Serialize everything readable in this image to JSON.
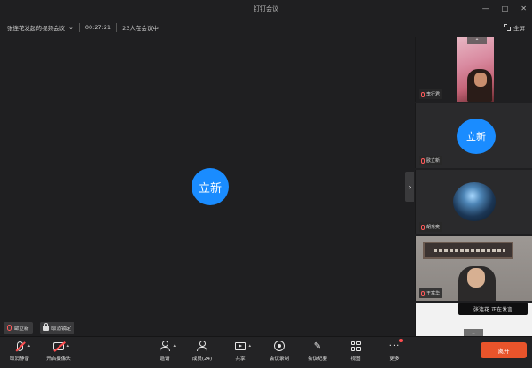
{
  "window": {
    "title": "钉钉会议",
    "controls": [
      "—",
      "□",
      "✕"
    ]
  },
  "info": {
    "subject": "张连花发起的视频会议",
    "duration": "00:27:21",
    "participants_status": "23人在会议中"
  },
  "fullscreen_label": "全屏",
  "main": {
    "avatar_text": "立新",
    "name_chip": "歐立新",
    "pin_label": "取消锁定"
  },
  "rail": {
    "tiles": [
      {
        "name": "李行君"
      },
      {
        "name": "歐立新",
        "avatar_text": "立新"
      },
      {
        "name": "胡东奕"
      },
      {
        "name": "王富华"
      }
    ],
    "up_arrow": "⌃",
    "down_arrow": "⌄"
  },
  "speaking_notice": "张连花  正在发言",
  "toolbar": {
    "unmute": "取消静音",
    "camera": "开启摄像头",
    "invite": "邀请",
    "members": "成员(24)",
    "share": "共享",
    "record": "会议录制",
    "minutes": "会议纪要",
    "view": "视图",
    "more": "更多",
    "leave": "离开"
  },
  "colors": {
    "avatar_blue": "#1a8cff",
    "leave_orange": "#e9542b",
    "mute_red": "#ff4d4f",
    "background": "#1f1f21"
  }
}
